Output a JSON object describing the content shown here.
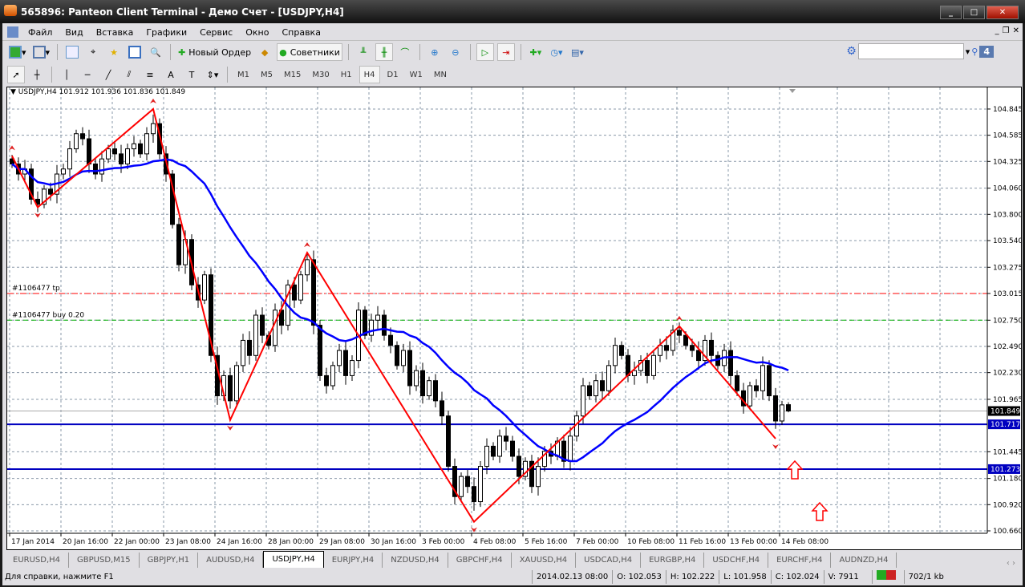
{
  "window": {
    "title": "565896: Panteon Client Terminal - Демо Счет - [USDJPY,H4]"
  },
  "menu": [
    "Файл",
    "Вид",
    "Вставка",
    "Графики",
    "Сервис",
    "Окно",
    "Справка"
  ],
  "toolbar": {
    "new_order": "Новый Ордер",
    "experts": "Советники",
    "timeframes": [
      "M1",
      "M5",
      "M15",
      "M30",
      "H1",
      "H4",
      "D1",
      "W1",
      "MN"
    ],
    "active_timeframe": "H4",
    "search_placeholder": "",
    "notifications": "4"
  },
  "chart_data": {
    "type": "candlestick",
    "symbol_header": "USDJPY,H4",
    "header_ohlc": "101.912 101.936 101.836 101.849",
    "last_bar": {
      "open": 101.912,
      "high": 101.936,
      "low": 101.836,
      "close": 101.849
    },
    "ylim": [
      100.66,
      104.88
    ],
    "y_ticks": [
      "104.845",
      "104.585",
      "104.325",
      "104.060",
      "103.800",
      "103.540",
      "103.275",
      "103.015",
      "102.750",
      "102.490",
      "102.230",
      "101.965",
      "101.445",
      "101.180",
      "100.920",
      "100.660"
    ],
    "x_ticks": [
      "17 Jan 2014",
      "20 Jan 16:00",
      "22 Jan 00:00",
      "23 Jan 08:00",
      "24 Jan 16:00",
      "28 Jan 00:00",
      "29 Jan 08:00",
      "30 Jan 16:00",
      "3 Feb 00:00",
      "4 Feb 08:00",
      "5 Feb 16:00",
      "7 Feb 00:00",
      "10 Feb 08:00",
      "11 Feb 16:00",
      "13 Feb 00:00",
      "14 Feb 08:00"
    ],
    "closes": [
      104.3,
      104.2,
      104.25,
      103.95,
      103.9,
      104.05,
      104.0,
      104.2,
      104.25,
      104.45,
      104.6,
      104.55,
      104.3,
      104.2,
      104.35,
      104.45,
      104.4,
      104.3,
      104.45,
      104.5,
      104.4,
      104.6,
      104.7,
      104.4,
      104.2,
      103.7,
      103.3,
      103.55,
      103.1,
      102.95,
      103.2,
      102.4,
      102.0,
      102.2,
      101.95,
      102.3,
      102.55,
      102.4,
      102.8,
      102.6,
      102.5,
      102.85,
      102.7,
      103.1,
      102.95,
      103.2,
      103.35,
      102.7,
      102.2,
      102.1,
      102.3,
      102.45,
      102.2,
      102.35,
      102.85,
      102.6,
      102.75,
      102.8,
      102.6,
      102.5,
      102.3,
      102.45,
      102.1,
      102.25,
      102.0,
      102.15,
      101.95,
      101.8,
      101.3,
      101.0,
      101.2,
      101.1,
      100.95,
      101.3,
      101.5,
      101.4,
      101.6,
      101.55,
      101.4,
      101.2,
      101.35,
      101.1,
      101.3,
      101.45,
      101.4,
      101.55,
      101.35,
      101.6,
      101.8,
      102.1,
      102.0,
      102.15,
      102.05,
      102.3,
      102.5,
      102.4,
      102.2,
      102.25,
      102.35,
      102.2,
      102.4,
      102.5,
      102.45,
      102.65,
      102.6,
      102.5,
      102.45,
      102.35,
      102.55,
      102.4,
      102.3,
      102.45,
      102.2,
      102.05,
      101.9,
      102.1,
      102.05,
      102.3,
      102.0,
      101.75,
      101.91,
      101.849
    ],
    "zigzag": [
      [
        0,
        104.38
      ],
      [
        4,
        103.87
      ],
      [
        22,
        104.845
      ],
      [
        34,
        101.76
      ],
      [
        46,
        103.42
      ],
      [
        72,
        100.75
      ],
      [
        104,
        102.69
      ],
      [
        119,
        101.575
      ]
    ],
    "ma_color": "#0000ff",
    "zigzag_color": "#ff0000",
    "levels": [
      {
        "label": "#1106477 tp",
        "price": 103.015,
        "color": "#ff0000",
        "style": "dashdot"
      },
      {
        "label": "#1106477 buy 0.20",
        "price": 102.75,
        "color": "#00b000",
        "style": "dash"
      },
      {
        "label": "",
        "price": 101.717,
        "color": "#0000c0",
        "style": "solid",
        "tag": "101.717"
      },
      {
        "label": "",
        "price": 101.273,
        "color": "#0000c0",
        "style": "solid",
        "tag": "101.273"
      }
    ],
    "current_price": "101.849"
  },
  "tabs": [
    "EURUSD,H4",
    "GBPUSD,M15",
    "GBPJPY,H1",
    "AUDUSD,H4",
    "USDJPY,H4",
    "EURJPY,H4",
    "NZDUSD,H4",
    "GBPCHF,H4",
    "XAUUSD,H4",
    "USDCAD,H4",
    "EURGBP,H4",
    "USDCHF,H4",
    "EURCHF,H4",
    "AUDNZD,H4"
  ],
  "active_tab": "USDJPY,H4",
  "status": {
    "help": "Для справки, нажмите F1",
    "time": "2014.02.13 08:00",
    "open": "O: 102.053",
    "high": "H: 102.222",
    "low": "L: 101.958",
    "close": "C: 102.024",
    "volume": "V: 7911",
    "traffic": "702/1 kb"
  }
}
